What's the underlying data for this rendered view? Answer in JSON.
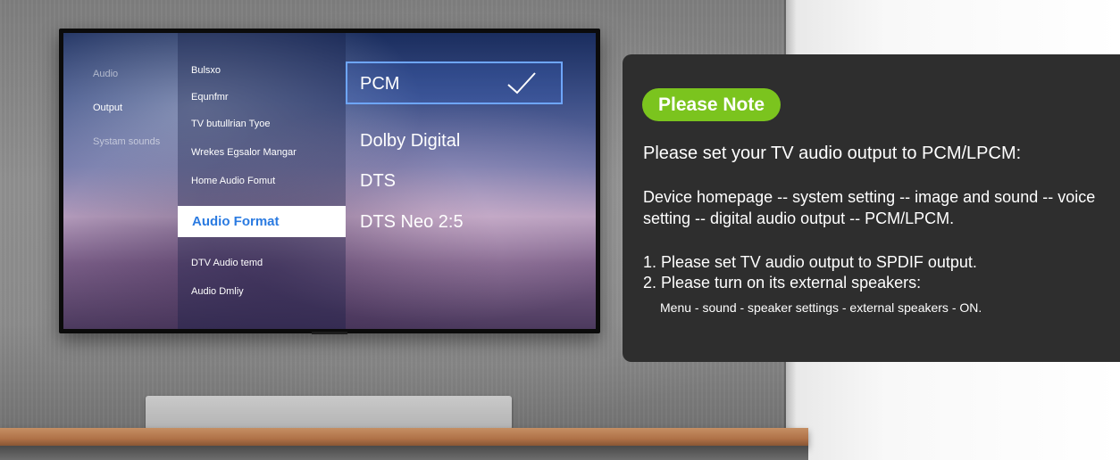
{
  "tv_menu": {
    "categories": [
      {
        "label": "Audio",
        "active": false
      },
      {
        "label": "Output",
        "active": true
      },
      {
        "label": "Systam sounds",
        "active": false
      }
    ],
    "settings": [
      "Bulsxo",
      "Equnfmr",
      "TV butullrian Tyoe",
      "Wrekes Egsalor Mangar",
      "Home Audio Fomut",
      "Audio Format",
      "DTV Audio temd",
      "Audio Dmliy"
    ],
    "selected_setting": "Audio Format",
    "options": [
      "PCM",
      "Dolby Digital",
      "DTS",
      "DTS Neo 2:5"
    ],
    "selected_option": "PCM"
  },
  "note": {
    "badge": "Please Note",
    "headline": "Please set your TV audio output to PCM/LPCM:",
    "path": "Device homepage -- system setting -- image and sound -- voice setting -- digital audio output -- PCM/LPCM.",
    "step1": "1. Please set TV audio output to SPDIF output.",
    "step2": "2. Please turn on its external speakers:",
    "step2_detail": "Menu - sound - speaker settings - external speakers - ON."
  },
  "colors": {
    "badge_green": "#7bc41e",
    "panel_bg": "#2e2e2e",
    "highlight_blue": "#2b7be1"
  }
}
